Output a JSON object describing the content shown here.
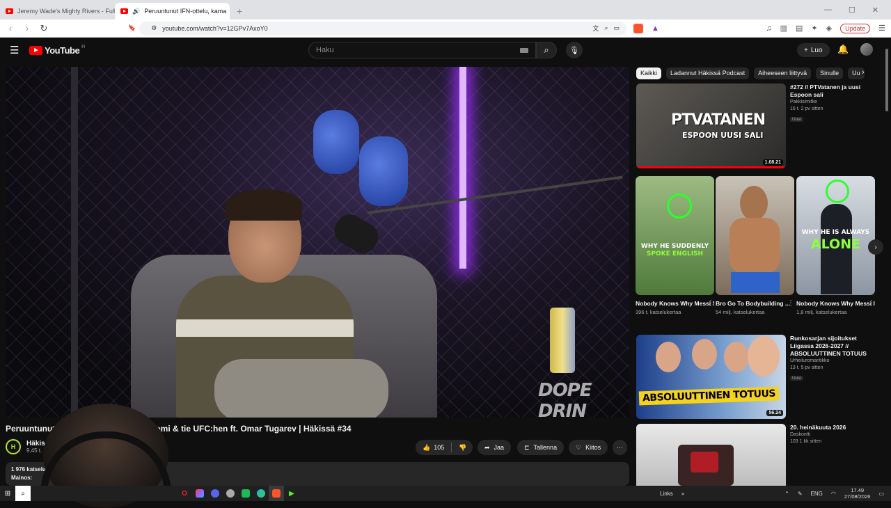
{
  "browser": {
    "tabs": [
      {
        "label": "Jeremy Wade's Mighty Rivers - Full E"
      },
      {
        "label": "Peruuntunut IFN-ottelu, kama"
      }
    ],
    "new_tab": "+",
    "url": "youtube.com/watch?v=12GPv7AxoY0",
    "update_label": "Update"
  },
  "header": {
    "logo_text": "YouTube",
    "country": "FI",
    "search_placeholder": "Haku",
    "create_label": "Luo"
  },
  "video": {
    "title": "Peruuntunut IFN-ottelu, kamppailu Suomi & tie UFC:hen ft. Omar Tugarev | Häkissä #34",
    "watermark": "DOPE DRIN",
    "channel_name": "Häkissä P",
    "channel_subs": "9,45 t. tilaajaa",
    "likes": "105",
    "share_label": "Jaa",
    "save_label": "Tallenna",
    "thanks_label": "Kiitos",
    "views_line": "1 976 katselukertaa",
    "ads_line": "Mainos:"
  },
  "chips": [
    {
      "label": "Kaikki",
      "active": true
    },
    {
      "label": "Ladannut Häkissä Podcast"
    },
    {
      "label": "Aiheeseen liittyvä"
    },
    {
      "label": "Sinulle"
    },
    {
      "label": "Uu"
    }
  ],
  "recommendations": [
    {
      "title": "#272 // PTVatanen ja uusi Espoon sali",
      "channel": "Pakkisimitke",
      "views": "16 t. 2 pv sitten",
      "badge": "Uusi",
      "duration": "1.08.21",
      "thumb_text_1": "PTVATANEN",
      "thumb_text_2": "ESPOON UUSI SALI",
      "progress": 1.0
    },
    {
      "title": "Runkosarjan sijoitukset Liigassa 2026-2027 // ABSOLUUTTINEN TOTUUS",
      "channel": "Urheiluromantikko",
      "views": "13 t. 5 pv sitten",
      "badge": "Uusi",
      "duration": "56.24",
      "thumb_text_1": "ABSOLUUTTINEN TOTUUS"
    },
    {
      "title": "20. heinäkuuta 2026",
      "channel": "Daskontti",
      "views": "103 1 kk sitten"
    }
  ],
  "shorts": [
    {
      "title": "Nobody Knows Why Messi Suddenly ...",
      "views": "396 t. katselukertaa",
      "overlay_1": "WHY HE SUDDENLY",
      "overlay_2": "SPOKE ENGLISH"
    },
    {
      "title": "Bro Go To Bodybuilding ...",
      "views": "54 milj. katselukertaa"
    },
    {
      "title": "Nobody Knows Why Messi Is Always ...",
      "views": "1,8 milj. katselukertaa",
      "overlay_1": "WHY HE IS ALWAYS",
      "overlay_2": "ALONE"
    }
  ],
  "taskbar": {
    "links_label": "Links",
    "lang": "ENG",
    "time": "17.49",
    "date": "27/08/2026"
  },
  "colors": {
    "yt_red": "#ff0000",
    "bg": "#0f0f0f",
    "neon_green": "#b5e61d"
  }
}
